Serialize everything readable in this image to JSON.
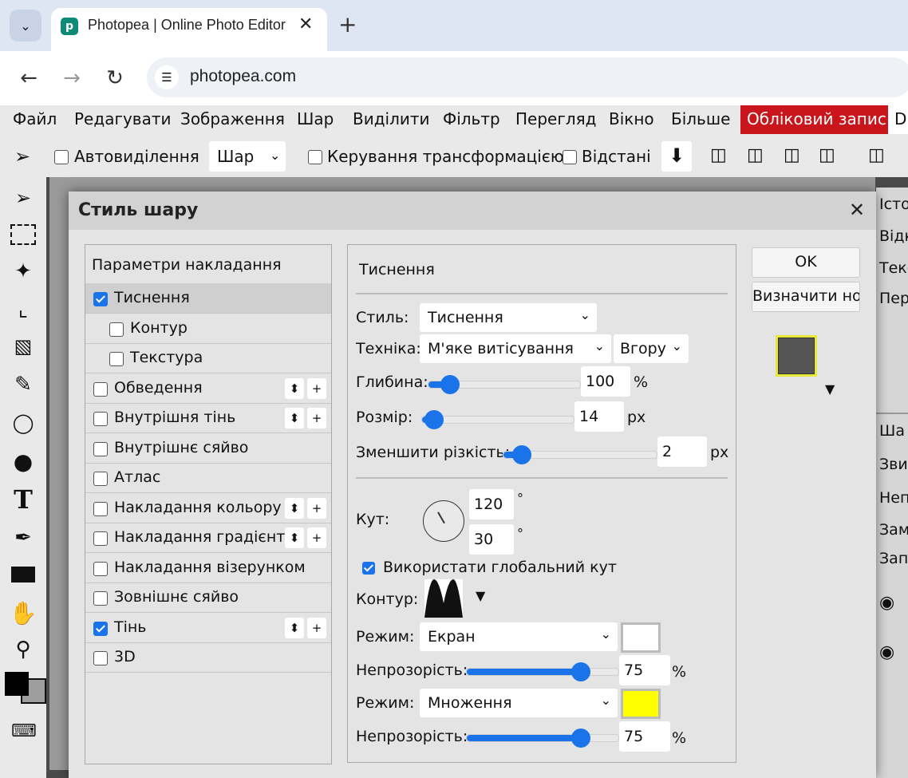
{
  "browser": {
    "tab_title": "Photopea | Online Photo Editor",
    "url": "photopea.com"
  },
  "menu": {
    "items": [
      "Файл",
      "Редагувати",
      "Зображення",
      "Шар",
      "Виділити",
      "Фільтр",
      "Перегляд",
      "Вікно",
      "Більше"
    ],
    "account": "Обліковий запис",
    "overflow": "D"
  },
  "options_bar": {
    "auto_select": "Автовиділення",
    "layer_select": "Шар",
    "transform_controls": "Керування трансформацією",
    "distances": "Відстані"
  },
  "right_panel": {
    "items_top": [
      "Істо",
      "Відк",
      "Текс",
      "Пер"
    ],
    "items_bottom": [
      "Ша",
      "Зви",
      "Непр",
      "Замо",
      "Запо"
    ]
  },
  "dialog": {
    "title": "Стиль шару",
    "blending_options": "Параметри накладання",
    "styles": [
      {
        "label": "Тиснення",
        "checked": true,
        "indent": false,
        "buttons": false,
        "selected": true
      },
      {
        "label": "Контур",
        "checked": false,
        "indent": true,
        "buttons": false
      },
      {
        "label": "Текстура",
        "checked": false,
        "indent": true,
        "buttons": false
      },
      {
        "label": "Обведення",
        "checked": false,
        "indent": false,
        "buttons": true
      },
      {
        "label": "Внутрішня тінь",
        "checked": false,
        "indent": false,
        "buttons": true
      },
      {
        "label": "Внутрішнє сяйво",
        "checked": false,
        "indent": false,
        "buttons": false
      },
      {
        "label": "Атлас",
        "checked": false,
        "indent": false,
        "buttons": false
      },
      {
        "label": "Накладання кольору",
        "checked": false,
        "indent": false,
        "buttons": true
      },
      {
        "label": "Накладання градієнта",
        "checked": false,
        "indent": false,
        "buttons": true
      },
      {
        "label": "Накладання візерунком",
        "checked": false,
        "indent": false,
        "buttons": false
      },
      {
        "label": "Зовнішнє сяйво",
        "checked": false,
        "indent": false,
        "buttons": false
      },
      {
        "label": "Тінь",
        "checked": true,
        "indent": false,
        "buttons": true
      },
      {
        "label": "3D",
        "checked": false,
        "indent": false,
        "buttons": false
      }
    ],
    "settings": {
      "section_title": "Тиснення",
      "style_label": "Стиль:",
      "style_value": "Тиснення",
      "technique_label": "Техніка:",
      "technique_value": "М'яке витісування",
      "direction_value": "Вгору",
      "depth_label": "Глибина:",
      "depth_value": "100",
      "depth_fraction": 0.14,
      "depth_unit": "%",
      "size_label": "Розмір:",
      "size_value": "14",
      "size_fraction": 0.08,
      "size_unit": "px",
      "soften_label": "Зменшити різкість:",
      "soften_value": "2",
      "soften_fraction": 0.12,
      "soften_unit": "px",
      "angle_label": "Кут:",
      "angle_value": "120",
      "altitude_value": "30",
      "degree": "°",
      "global_angle": "Використати глобальний кут",
      "global_angle_checked": true,
      "contour_label": "Контур:",
      "highlight_mode_label": "Режим:",
      "highlight_mode": "Екран",
      "highlight_color": "#ffffff",
      "highlight_opacity_label": "Непрозорість:",
      "highlight_opacity": "75",
      "highlight_opacity_fraction": 0.75,
      "shadow_mode_label": "Режим:",
      "shadow_mode": "Множення",
      "shadow_color": "#ffff00",
      "shadow_opacity_label": "Непрозорість:",
      "shadow_opacity": "75",
      "shadow_opacity_fraction": 0.75,
      "percent": "%"
    },
    "ok": "OK",
    "new_style": "Визначити но"
  },
  "colors": {
    "accent": "#1a73e8",
    "account_red": "#c9151b",
    "foreground": "#000000",
    "background": "#9e9e9e"
  }
}
